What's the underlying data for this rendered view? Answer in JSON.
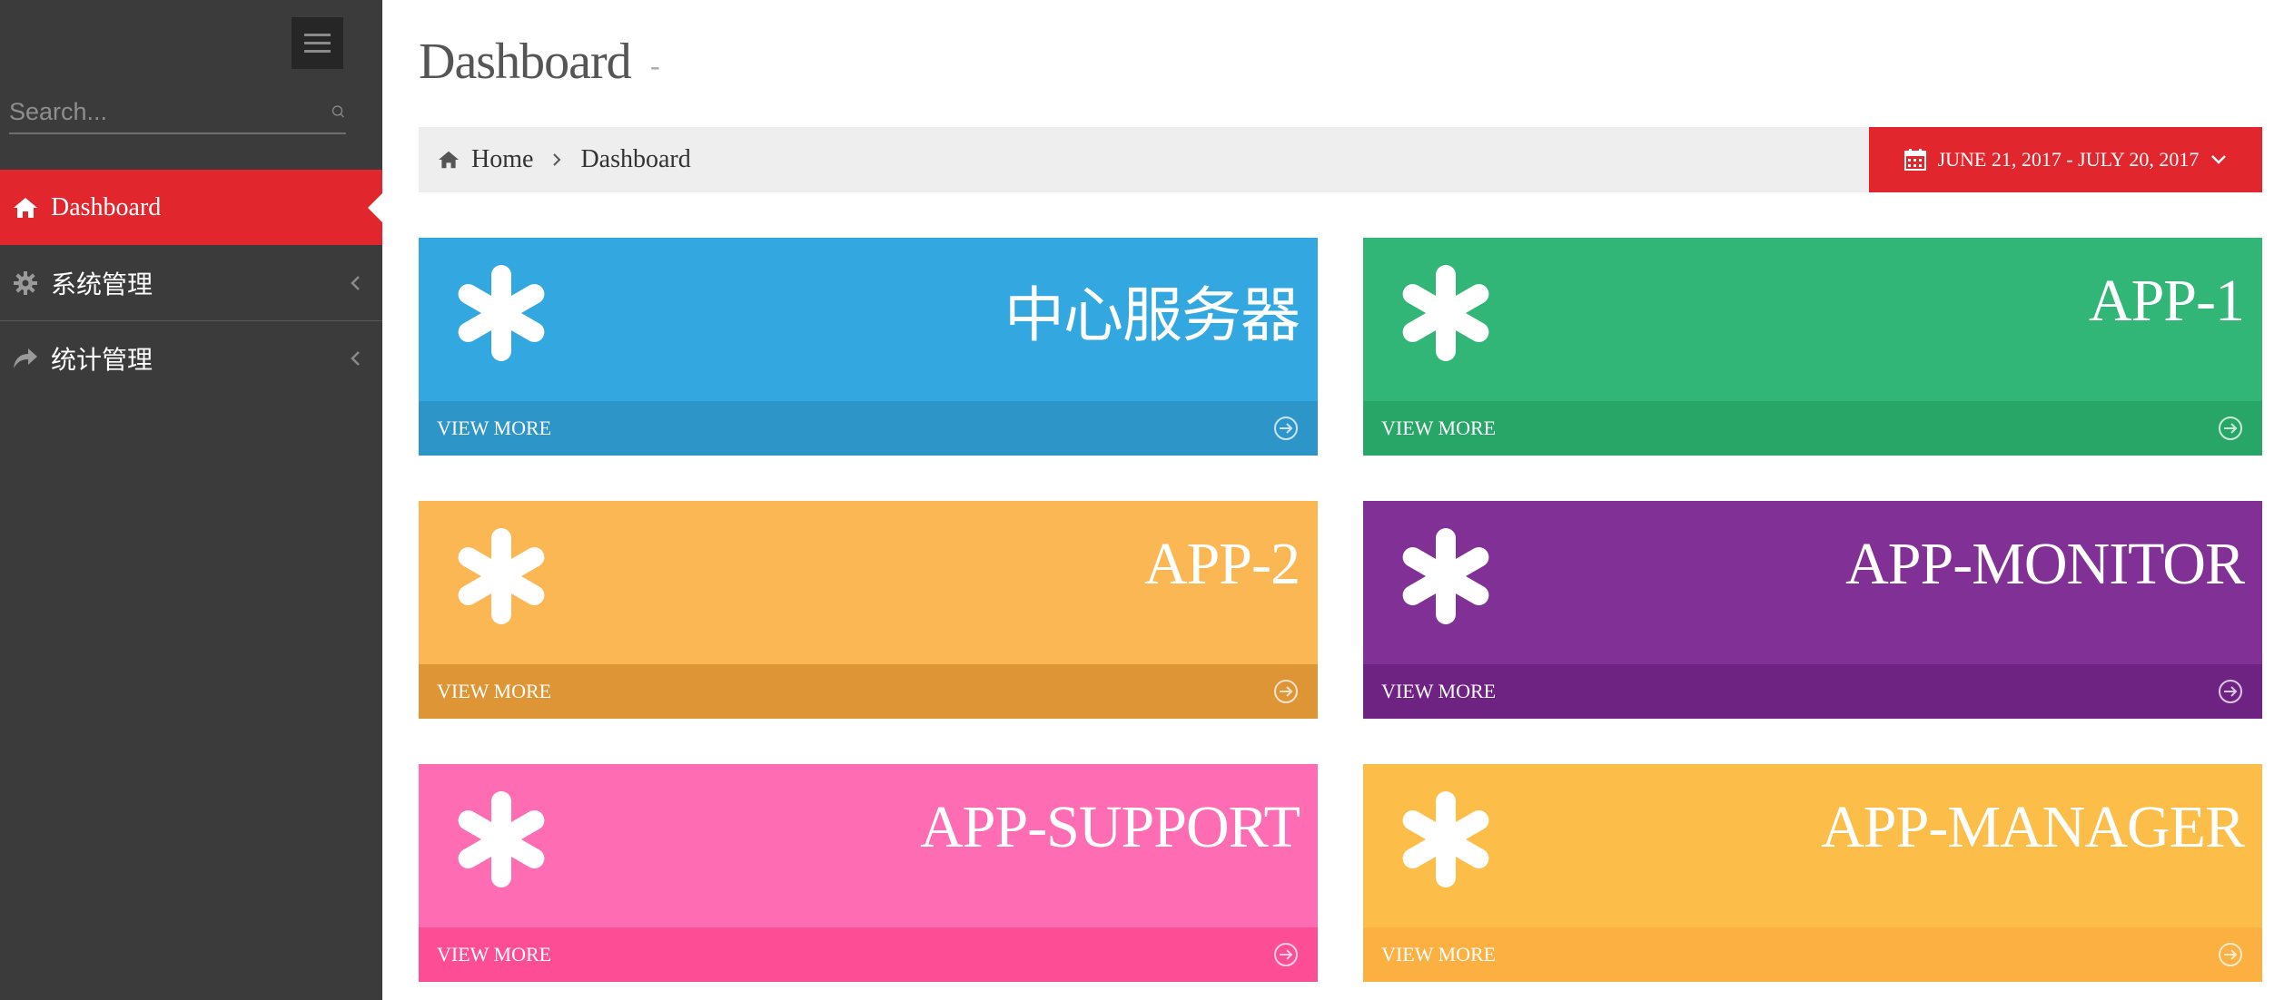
{
  "sidebar": {
    "search": {
      "placeholder": "Search..."
    },
    "items": [
      {
        "label": "Dashboard",
        "icon": "home-icon",
        "active": true
      },
      {
        "label": "系统管理",
        "icon": "gear-icon",
        "active": false
      },
      {
        "label": "统计管理",
        "icon": "share-icon",
        "active": false
      }
    ]
  },
  "header": {
    "title": "Dashboard",
    "title_suffix": "-",
    "breadcrumb": {
      "home": "Home",
      "current": "Dashboard"
    },
    "date_range": "JUNE 21, 2017 - JULY 20, 2017"
  },
  "cards": [
    {
      "title": "中心服务器",
      "link": "VIEW MORE",
      "color": "#33a8e0",
      "footer_color": "#2d95c8"
    },
    {
      "title": "APP-1",
      "link": "VIEW MORE",
      "color": "#31b677",
      "footer_color": "#28a667"
    },
    {
      "title": "APP-2",
      "link": "VIEW MORE",
      "color": "#fbb754",
      "footer_color": "#dd9535"
    },
    {
      "title": "APP-MONITOR",
      "link": "VIEW MORE",
      "color": "#813095",
      "footer_color": "#6e2282"
    },
    {
      "title": "APP-SUPPORT",
      "link": "VIEW MORE",
      "color": "#fe6db3",
      "footer_color": "#fc4d95"
    },
    {
      "title": "APP-MANAGER",
      "link": "VIEW MORE",
      "color": "#fdbe49",
      "footer_color": "#fcb041"
    }
  ],
  "colors": {
    "accent": "#e2262d",
    "sidebar_bg": "#3b3b3b"
  }
}
